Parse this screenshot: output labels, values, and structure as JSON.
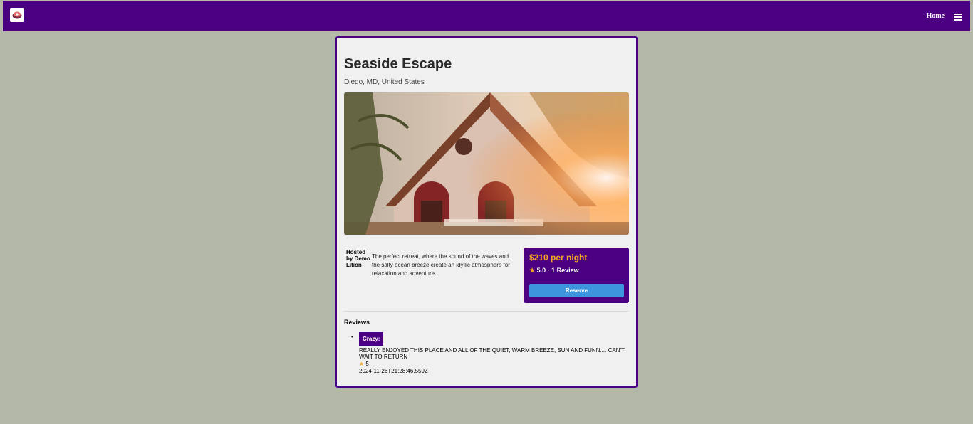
{
  "nav": {
    "home_label": "Home",
    "logo_icon": "logo-icon",
    "menu_icon": "hamburger-menu-icon"
  },
  "colors": {
    "nav_bg": "#4b0082",
    "page_bg": "#b3b8a9",
    "price": "#f5a623",
    "reserve_button": "#3d96dd"
  },
  "listing": {
    "title": "Seaside Escape",
    "location": "Diego, MD, United States",
    "host": "Hosted by Demo Lition",
    "description": "The perfect retreat, where the sound of the waves and the salty ocean breeze create an idyllic atmosphere for relaxation and adventure."
  },
  "booking": {
    "price": "$210 per night",
    "star": "★",
    "rating": "5.0",
    "separator": "·",
    "review_count": "1 Review",
    "reserve_label": "Reserve"
  },
  "reviews": {
    "heading": "Reviews",
    "items": [
      {
        "reviewer": "Crazy:",
        "text": "REALLY ENJOYED THIS PLACE AND ALL OF THE QUIET, WARM BREEZE, SUN AND FUNN.... CAN'T WAIT TO RETURN",
        "star": "★",
        "stars": "5",
        "date": "2024-11-26T21:28:46.559Z"
      }
    ]
  }
}
